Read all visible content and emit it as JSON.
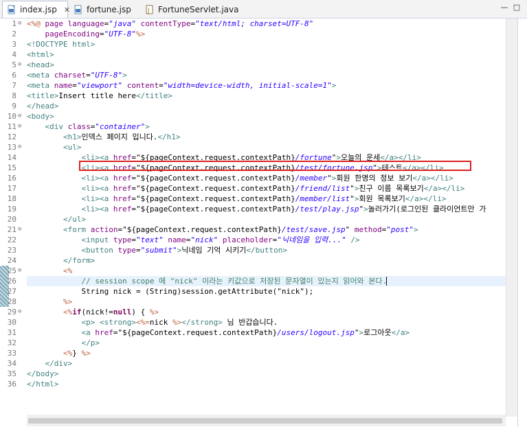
{
  "tabs": [
    {
      "label": "index.jsp",
      "close": "✕",
      "active": true
    },
    {
      "label": "fortune.jsp",
      "active": false
    },
    {
      "label": "FortuneServlet.java",
      "active": false
    }
  ],
  "window_buttons": {
    "minimize": "—",
    "maximize": "□"
  },
  "line_numbers": [
    "1",
    "2",
    "3",
    "4",
    "5",
    "6",
    "7",
    "8",
    "9",
    "10",
    "11",
    "12",
    "13",
    "14",
    "15",
    "16",
    "17",
    "18",
    "19",
    "20",
    "21",
    "22",
    "23",
    "24",
    "25",
    "26",
    "27",
    "28",
    "29",
    "30",
    "31",
    "32",
    "33",
    "34",
    "35",
    "36"
  ],
  "fold_markers": {
    "1": "⊖",
    "5": "⊖",
    "10": "⊖",
    "11": "⊖",
    "13": "⊖",
    "21": "⊖",
    "25": "⊖",
    "29": "⊖"
  },
  "code_lines": [
    [
      [
        "jsp",
        "<%@ "
      ],
      [
        "attr",
        "page "
      ],
      [
        "attr",
        "language"
      ],
      [
        "txt",
        "="
      ],
      [
        "str",
        "\"java\""
      ],
      [
        "txt",
        " "
      ],
      [
        "attr",
        "contentType"
      ],
      [
        "txt",
        "="
      ],
      [
        "str",
        "\"text/html; charset=UTF-8\""
      ]
    ],
    [
      [
        "txt",
        "    "
      ],
      [
        "attr",
        "pageEncoding"
      ],
      [
        "txt",
        "="
      ],
      [
        "str",
        "\"UTF-8\""
      ],
      [
        "jsp",
        "%>"
      ]
    ],
    [
      [
        "tag",
        "<!DOCTYPE html>"
      ]
    ],
    [
      [
        "tag",
        "<html>"
      ]
    ],
    [
      [
        "tag",
        "<head>"
      ]
    ],
    [
      [
        "tag",
        "<meta "
      ],
      [
        "attr",
        "charset"
      ],
      [
        "txt",
        "="
      ],
      [
        "str",
        "\"UTF-8\""
      ],
      [
        "tag",
        ">"
      ]
    ],
    [
      [
        "tag",
        "<meta "
      ],
      [
        "attr",
        "name"
      ],
      [
        "txt",
        "="
      ],
      [
        "str",
        "\"viewport\""
      ],
      [
        "txt",
        " "
      ],
      [
        "attr",
        "content"
      ],
      [
        "txt",
        "="
      ],
      [
        "str",
        "\"width=device-width, initial-scale=1\""
      ],
      [
        "tag",
        ">"
      ]
    ],
    [
      [
        "tag",
        "<title>"
      ],
      [
        "txt",
        "Insert title here"
      ],
      [
        "tag",
        "</title>"
      ]
    ],
    [
      [
        "tag",
        "</head>"
      ]
    ],
    [
      [
        "tag",
        "<body>"
      ]
    ],
    [
      [
        "txt",
        "    "
      ],
      [
        "tag",
        "<div "
      ],
      [
        "attr",
        "class"
      ],
      [
        "txt",
        "="
      ],
      [
        "str",
        "\"container\""
      ],
      [
        "tag",
        ">"
      ]
    ],
    [
      [
        "txt",
        "        "
      ],
      [
        "tag",
        "<h1>"
      ],
      [
        "txt",
        "인덱스 페이지 입니다."
      ],
      [
        "tag",
        "</h1>"
      ]
    ],
    [
      [
        "txt",
        "        "
      ],
      [
        "tag",
        "<ul>"
      ]
    ],
    [
      [
        "txt",
        "            "
      ],
      [
        "tag",
        "<li><a "
      ],
      [
        "attr",
        "href"
      ],
      [
        "txt",
        "=\"${pageContext.request.contextPath}"
      ],
      [
        "str",
        "/fortune"
      ],
      [
        "txt",
        "\""
      ],
      [
        "tag",
        ">"
      ],
      [
        "txt",
        "오늘의 운세"
      ],
      [
        "tag",
        "</a></li>"
      ]
    ],
    [
      [
        "txt",
        "            "
      ],
      [
        "tag",
        "<li><a "
      ],
      [
        "attr",
        "href"
      ],
      [
        "txt",
        "=\"${pageContext.request.contextPath}"
      ],
      [
        "str",
        "/test/fortune.jsp"
      ],
      [
        "txt",
        "\""
      ],
      [
        "tag",
        ">"
      ],
      [
        "txt",
        "테스트"
      ],
      [
        "tag",
        "</a></li>"
      ]
    ],
    [
      [
        "txt",
        "            "
      ],
      [
        "tag",
        "<li><a "
      ],
      [
        "attr",
        "href"
      ],
      [
        "txt",
        "=\"${pageContext.request.contextPath}"
      ],
      [
        "str",
        "/member"
      ],
      [
        "txt",
        "\""
      ],
      [
        "tag",
        ">"
      ],
      [
        "txt",
        "회원 한명의 정보 보기"
      ],
      [
        "tag",
        "</a></li>"
      ]
    ],
    [
      [
        "txt",
        "            "
      ],
      [
        "tag",
        "<li><a "
      ],
      [
        "attr",
        "href"
      ],
      [
        "txt",
        "=\"${pageContext.request.contextPath}"
      ],
      [
        "str",
        "/friend/list"
      ],
      [
        "txt",
        "\""
      ],
      [
        "tag",
        ">"
      ],
      [
        "txt",
        "친구 이름 목록보기"
      ],
      [
        "tag",
        "</a></li>"
      ]
    ],
    [
      [
        "txt",
        "            "
      ],
      [
        "tag",
        "<li><a "
      ],
      [
        "attr",
        "href"
      ],
      [
        "txt",
        "=\"${pageContext.request.contextPath}"
      ],
      [
        "str",
        "/member/list"
      ],
      [
        "txt",
        "\""
      ],
      [
        "tag",
        ">"
      ],
      [
        "txt",
        "회원 목록보기"
      ],
      [
        "tag",
        "</a></li>"
      ]
    ],
    [
      [
        "txt",
        "            "
      ],
      [
        "tag",
        "<li><a "
      ],
      [
        "attr",
        "href"
      ],
      [
        "txt",
        "=\"${pageContext.request.contextPath}"
      ],
      [
        "str",
        "/test/play.jsp"
      ],
      [
        "txt",
        "\""
      ],
      [
        "tag",
        ">"
      ],
      [
        "txt",
        "놀러가기(로그인된 클라이언트만 가"
      ]
    ],
    [
      [
        "txt",
        "        "
      ],
      [
        "tag",
        "</ul>"
      ]
    ],
    [
      [
        "txt",
        "        "
      ],
      [
        "tag",
        "<form "
      ],
      [
        "attr",
        "action"
      ],
      [
        "txt",
        "=\"${pageContext.request.contextPath}"
      ],
      [
        "str",
        "/test/save.jsp"
      ],
      [
        "txt",
        "\" "
      ],
      [
        "attr",
        "method"
      ],
      [
        "txt",
        "="
      ],
      [
        "str",
        "\"post\""
      ],
      [
        "tag",
        ">"
      ]
    ],
    [
      [
        "txt",
        "            "
      ],
      [
        "tag",
        "<input "
      ],
      [
        "attr",
        "type"
      ],
      [
        "txt",
        "="
      ],
      [
        "str",
        "\"text\""
      ],
      [
        "txt",
        " "
      ],
      [
        "attr",
        "name"
      ],
      [
        "txt",
        "="
      ],
      [
        "str",
        "\"nick\""
      ],
      [
        "txt",
        " "
      ],
      [
        "attr",
        "placeholder"
      ],
      [
        "txt",
        "="
      ],
      [
        "str",
        "\"닉네임을 입력...\""
      ],
      [
        "txt",
        " "
      ],
      [
        "tag",
        "/>"
      ]
    ],
    [
      [
        "txt",
        "            "
      ],
      [
        "tag",
        "<button "
      ],
      [
        "attr",
        "type"
      ],
      [
        "txt",
        "="
      ],
      [
        "str",
        "\"submit\""
      ],
      [
        "tag",
        ">"
      ],
      [
        "txt",
        "닉네임 기억 시키기"
      ],
      [
        "tag",
        "</button>"
      ]
    ],
    [
      [
        "txt",
        "        "
      ],
      [
        "tag",
        "</form>"
      ]
    ],
    [
      [
        "txt",
        "        "
      ],
      [
        "jsp",
        "<%"
      ]
    ],
    [
      [
        "txt",
        "            "
      ],
      [
        "com",
        "// session scope 에 \"nick\" 이라는 키값으로 저장된 문자열이 있는지 읽어와 본다."
      ]
    ],
    [
      [
        "txt",
        "            String nick = (String)session.getAttribute(\"nick\");"
      ]
    ],
    [
      [
        "txt",
        "        "
      ],
      [
        "jsp",
        "%>"
      ]
    ],
    [
      [
        "txt",
        "        "
      ],
      [
        "jsp",
        "<%"
      ],
      [
        "kw",
        "if"
      ],
      [
        "txt",
        "(nick!="
      ],
      [
        "kw",
        "null"
      ],
      [
        "txt",
        ") { "
      ],
      [
        "jsp",
        "%>"
      ]
    ],
    [
      [
        "txt",
        "            "
      ],
      [
        "tag",
        "<p> <strong>"
      ],
      [
        "jsp",
        "<%="
      ],
      [
        "txt",
        "nick "
      ],
      [
        "jsp",
        "%>"
      ],
      [
        "tag",
        "</strong>"
      ],
      [
        "txt",
        " 님 반갑습니다."
      ]
    ],
    [
      [
        "txt",
        "            "
      ],
      [
        "tag",
        "<a "
      ],
      [
        "attr",
        "href"
      ],
      [
        "txt",
        "=\"${pageContext.request.contextPath}"
      ],
      [
        "str",
        "/users/logout.jsp"
      ],
      [
        "txt",
        "\""
      ],
      [
        "tag",
        ">"
      ],
      [
        "txt",
        "로그아웃"
      ],
      [
        "tag",
        "</a>"
      ]
    ],
    [
      [
        "txt",
        "            "
      ],
      [
        "tag",
        "</p>"
      ]
    ],
    [
      [
        "txt",
        "        "
      ],
      [
        "jsp",
        "<%"
      ],
      [
        "txt",
        "} "
      ],
      [
        "jsp",
        "%>"
      ]
    ],
    [
      [
        "txt",
        "    "
      ],
      [
        "tag",
        "</div>"
      ]
    ],
    [
      [
        "tag",
        "</body>"
      ]
    ],
    [
      [
        "tag",
        "</html>"
      ]
    ]
  ],
  "highlight": {
    "current_line": 26,
    "boxed_line": 15,
    "box_color": "#d9201f"
  }
}
